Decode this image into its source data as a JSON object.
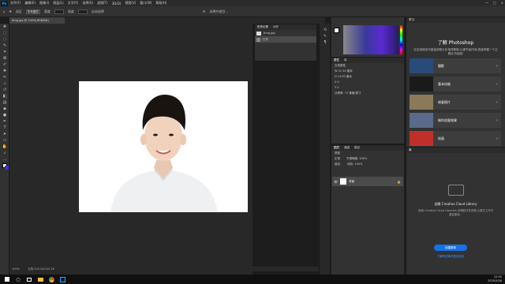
{
  "menubar": {
    "app_icon": "Ps",
    "items": [
      "文件(F)",
      "编辑(E)",
      "图像(I)",
      "图层(L)",
      "文字(Y)",
      "选择(S)",
      "滤镜(T)",
      "3D(D)",
      "视图(V)",
      "窗口(W)",
      "帮助(H)"
    ],
    "window_controls": [
      "—",
      "□",
      "×"
    ]
  },
  "optionsbar": {
    "sample_label": "选区",
    "mode_value": "所有图层",
    "width_label": "宽度",
    "height_label": "高度",
    "auto_label": "自动选择",
    "select_subject": "选择并遮住..."
  },
  "document": {
    "tab_label": "timg.jpg @ 100%(RGB/8#)",
    "zoom": "100%",
    "doc_size": "文档:155.2K/155.2K"
  },
  "history_panel": {
    "tabs": [
      "历史记录",
      "动作"
    ],
    "rows": [
      "timg.jpg",
      "打开"
    ]
  },
  "color_panel": {
    "accent": "#5a2ad0"
  },
  "properties_panel": {
    "tabs": [
      "属性",
      "库"
    ],
    "title": "文档属性",
    "rows": [
      "W  21.34 厘米",
      "H  14.99 厘米",
      "X  0",
      "Y  0",
      "分辨率: 72 像素/英寸"
    ]
  },
  "layers_panel": {
    "tabs": [
      "图层",
      "通道",
      "路径"
    ],
    "filter_label": "类型",
    "blend_mode": "正常",
    "opacity_label": "不透明度: 100%",
    "lock_label": "锁定:",
    "fill_label": "填充: 100%",
    "layer_name": "背景"
  },
  "learn_panel": {
    "tab": "学习",
    "title": "了解 Photoshop",
    "description": "在应用程序内直接按照分步指导教程,以便节省时间,快速掌握一个主题并开始做!",
    "cards": [
      {
        "label": "摄影",
        "color": "#2a4a7a"
      },
      {
        "label": "基本技能",
        "color": "#1a1a1a"
      },
      {
        "label": "修复照片",
        "color": "#8a7a5a"
      },
      {
        "label": "制作创意效果",
        "color": "#5a6a8a"
      },
      {
        "label": "绘画",
        "color": "#c0302a"
      }
    ]
  },
  "library_panel": {
    "tab": "库",
    "title": "创建 Creative Cloud Library",
    "description": "使用 Creative Cloud Libraries 存储和共享资源,以便在工作中重复使用。",
    "button": "创建新库",
    "link": "了解有关库的更多信息"
  },
  "taskbar": {
    "time": "12:02",
    "date": "2020/3/26",
    "icons": [
      "windows-icon",
      "search-icon",
      "task-view-icon",
      "explorer-icon",
      "chrome-icon",
      "photoshop-icon"
    ]
  }
}
